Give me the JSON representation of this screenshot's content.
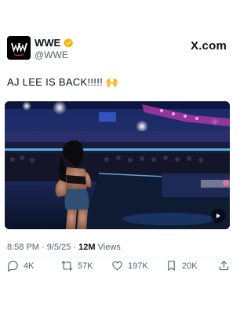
{
  "account": {
    "name": "WWE",
    "handle": "@WWE",
    "verified_color": "#f4b400"
  },
  "brand": {
    "site": "X.com"
  },
  "tweet": {
    "text": "AJ LEE IS BACK!!!!! 🙌",
    "time": "8:58 PM",
    "date": "9/5/25",
    "separator": "·",
    "views_count": "12M",
    "views_label": "Views"
  },
  "actions": {
    "replies": "4K",
    "reposts": "57K",
    "likes": "197K",
    "bookmarks": "20K"
  },
  "icons": [
    "wwe-logo-icon",
    "verified-badge-icon",
    "reply-icon",
    "repost-icon",
    "like-icon",
    "bookmark-icon",
    "share-icon",
    "play-icon"
  ],
  "colors": {
    "text": "#0f1419",
    "secondary": "#536471",
    "divider": "#eff3f4"
  }
}
